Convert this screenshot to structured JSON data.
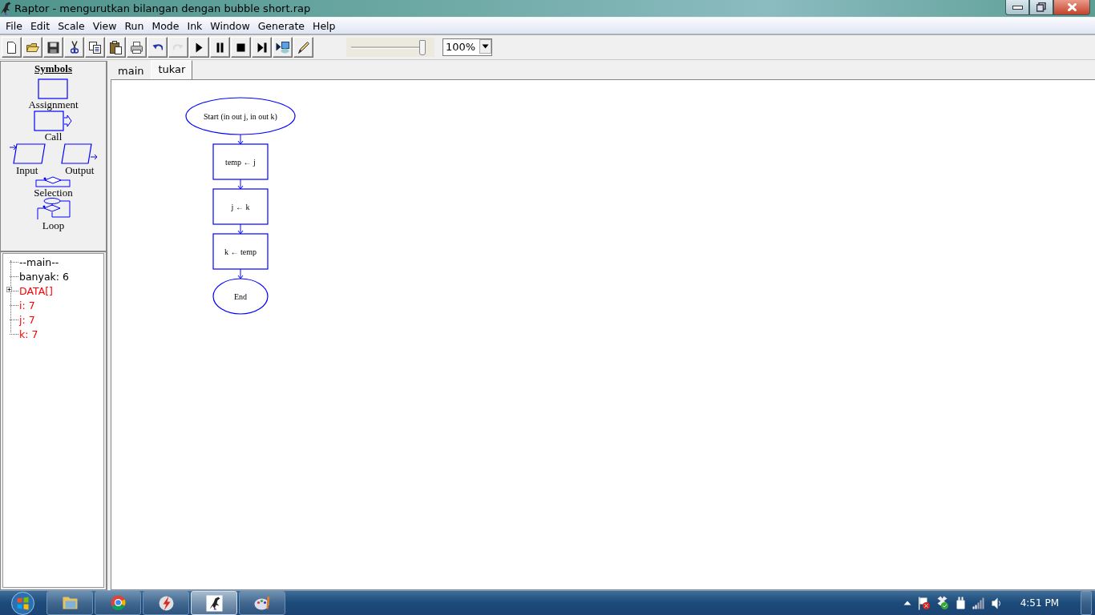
{
  "window": {
    "title": "Raptor - mengurutkan bilangan dengan bubble short.rap"
  },
  "menu": [
    "File",
    "Edit",
    "Scale",
    "View",
    "Run",
    "Mode",
    "Ink",
    "Window",
    "Generate",
    "Help"
  ],
  "toolbar": {
    "buttons": [
      {
        "kind": "new",
        "disabled": false
      },
      {
        "kind": "open",
        "disabled": false
      },
      {
        "kind": "save",
        "disabled": false
      },
      {
        "kind": "cut",
        "disabled": false
      },
      {
        "kind": "copy",
        "disabled": false
      },
      {
        "kind": "paste",
        "disabled": false
      },
      {
        "kind": "print",
        "disabled": false
      },
      {
        "kind": "undo",
        "disabled": false
      },
      {
        "kind": "redo",
        "disabled": true
      },
      {
        "kind": "run",
        "disabled": false
      },
      {
        "kind": "pause",
        "disabled": false
      },
      {
        "kind": "stop",
        "disabled": false
      },
      {
        "kind": "step",
        "disabled": false
      },
      {
        "kind": "monitor",
        "disabled": false
      },
      {
        "kind": "pen",
        "disabled": false
      }
    ],
    "speed": {
      "level": 0.97
    },
    "zoom": {
      "value": "100%"
    }
  },
  "symbols": {
    "title": "Symbols",
    "items": [
      {
        "kind": "assignment",
        "label": "Assignment"
      },
      {
        "kind": "call",
        "label": "Call"
      },
      {
        "kind": "input",
        "label": "Input"
      },
      {
        "kind": "output",
        "label": "Output"
      },
      {
        "kind": "selection",
        "label": "Selection"
      },
      {
        "kind": "loop",
        "label": "Loop"
      }
    ]
  },
  "variables": [
    {
      "label": "--main--",
      "changed": false,
      "expandable": false
    },
    {
      "label": "banyak: 6",
      "changed": false,
      "expandable": false
    },
    {
      "label": "DATA[]",
      "changed": true,
      "expandable": true
    },
    {
      "label": "i: 7",
      "changed": true,
      "expandable": false
    },
    {
      "label": "j: 7",
      "changed": true,
      "expandable": false
    },
    {
      "label": "k: 7",
      "changed": true,
      "expandable": false
    }
  ],
  "tabs": [
    {
      "label": "main",
      "selected": false
    },
    {
      "label": "tukar",
      "selected": true
    }
  ],
  "flowchart": {
    "nodes": [
      {
        "kind": "terminal",
        "text": "Start (in out j, in out k)"
      },
      {
        "kind": "assignment",
        "text": "temp ← j"
      },
      {
        "kind": "assignment",
        "text": "j ← k"
      },
      {
        "kind": "assignment",
        "text": "k ← temp"
      },
      {
        "kind": "terminal",
        "text": "End"
      }
    ]
  },
  "taskbar": {
    "apps": [
      {
        "kind": "folder",
        "active": false
      },
      {
        "kind": "browser",
        "active": false
      },
      {
        "kind": "lightning",
        "active": false
      },
      {
        "kind": "dinosaur",
        "active": true
      },
      {
        "kind": "palette",
        "active": false
      }
    ],
    "clock": "4:51 PM"
  }
}
